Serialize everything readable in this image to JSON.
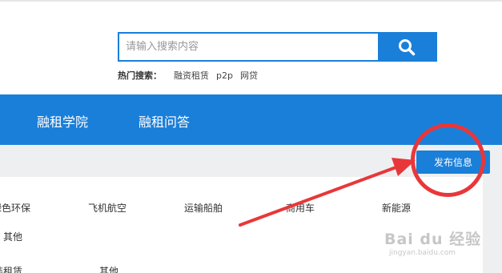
{
  "search": {
    "placeholder": "请输入搜索内容",
    "value": ""
  },
  "hot_search": {
    "label": "热门搜索：",
    "links": [
      "融资租赁",
      "p2p",
      "网贷"
    ]
  },
  "nav": {
    "items": [
      "融租学院",
      "融租问答"
    ]
  },
  "publish_button": "发布信息",
  "categories": {
    "row1": [
      "绿色环保",
      "飞机航空",
      "运输船舶",
      "商用车",
      "新能源"
    ],
    "row2": [
      "其他"
    ],
    "row3": [
      "装租赁",
      "其他"
    ]
  },
  "watermark": {
    "main": "Bai du 经验",
    "sub": "jingyan.baidu.com"
  },
  "colors": {
    "brand_blue": "#1a7fd9",
    "annotation_red": "#e8373a"
  }
}
